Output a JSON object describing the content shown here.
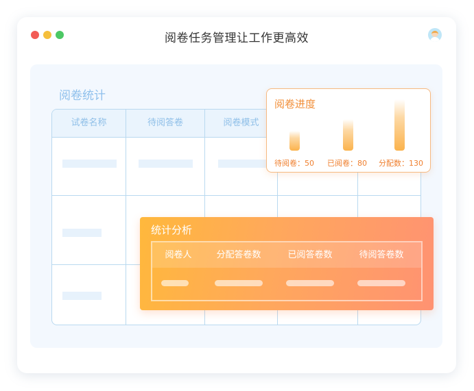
{
  "window": {
    "title": "阅卷任务管理让工作更高效",
    "traffic_lights": [
      "#f25b55",
      "#f5bf3c",
      "#4cc864"
    ],
    "avatar_icon": "user-avatar-icon"
  },
  "stats_panel": {
    "title": "阅卷统计",
    "columns": [
      "试卷名称",
      "待阅答卷",
      "阅卷模式"
    ]
  },
  "progress_card": {
    "title": "阅卷进度",
    "items": [
      {
        "label": "待阅卷：50",
        "value": 50
      },
      {
        "label": "已阅卷：80",
        "value": 80
      },
      {
        "label": "分配数：130",
        "value": 130
      }
    ],
    "accent": "#f28f3a"
  },
  "analysis_card": {
    "title": "统计分析",
    "columns": [
      "阅卷人",
      "分配答卷数",
      "已阅答卷数",
      "待阅答卷数"
    ],
    "gradient": [
      "#ffb83c",
      "#ff9272"
    ]
  }
}
